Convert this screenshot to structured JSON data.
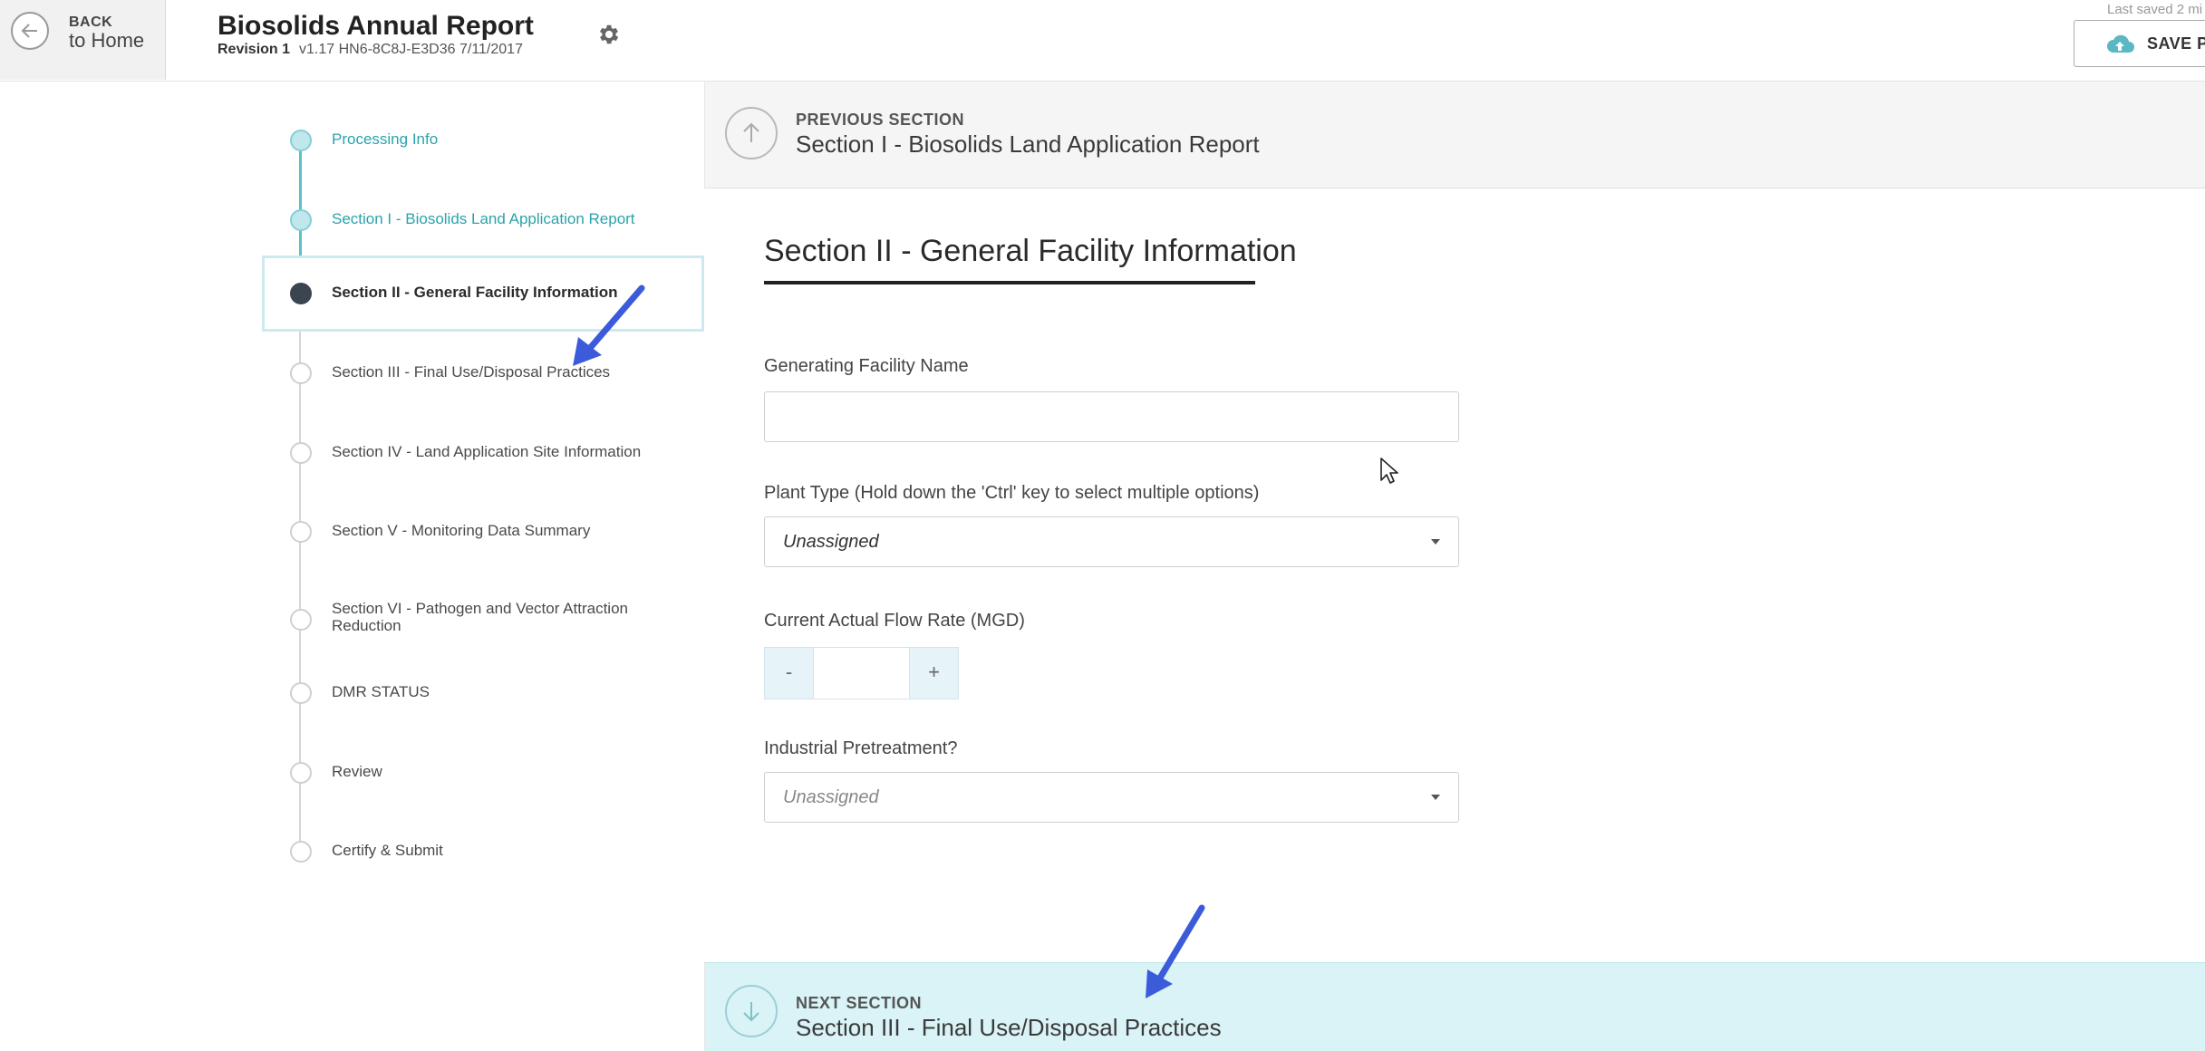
{
  "header": {
    "back_line1": "BACK",
    "back_line2": "to Home",
    "title": "Biosolids Annual Report",
    "revision_label": "Revision 1",
    "revision_meta": "v1.17   HN6-8C8J-E3D36   7/11/2017",
    "last_saved": "Last saved 2 mi",
    "save_label": "SAVE PF"
  },
  "sidebar": {
    "steps": [
      {
        "label": "Processing Info",
        "state": "done"
      },
      {
        "label": "Section I - Biosolids Land Application Report",
        "state": "done"
      },
      {
        "label": "Section II - General Facility Information",
        "state": "current"
      },
      {
        "label": "Section III - Final Use/Disposal Practices",
        "state": "todo"
      },
      {
        "label": "Section IV - Land Application Site Information",
        "state": "todo"
      },
      {
        "label": "Section V - Monitoring Data Summary",
        "state": "todo"
      },
      {
        "label": "Section VI - Pathogen and Vector Attraction Reduction",
        "state": "todo"
      },
      {
        "label": "DMR STATUS",
        "state": "todo"
      },
      {
        "label": "Review",
        "state": "todo"
      },
      {
        "label": "Certify & Submit",
        "state": "todo"
      }
    ]
  },
  "prev_section": {
    "kicker": "PREVIOUS SECTION",
    "title": "Section I - Biosolids Land Application Report"
  },
  "form": {
    "heading": "Section II - General Facility Information",
    "facility_name_label": "Generating Facility Name",
    "facility_name_value": "",
    "plant_type_label": "Plant Type (Hold down the 'Ctrl' key to select multiple options)",
    "plant_type_value": "Unassigned",
    "flow_rate_label": "Current Actual Flow Rate (MGD)",
    "flow_minus": "-",
    "flow_plus": "+",
    "flow_value": "",
    "pretreatment_label": "Industrial Pretreatment?",
    "pretreatment_value": "Unassigned"
  },
  "next_section": {
    "kicker": "NEXT SECTION",
    "title": "Section III - Final Use/Disposal Practices"
  },
  "colors": {
    "accent_teal": "#5bc0c8",
    "next_bar_bg": "#d9f3f6",
    "annotation_arrow": "#3b5bdb"
  }
}
